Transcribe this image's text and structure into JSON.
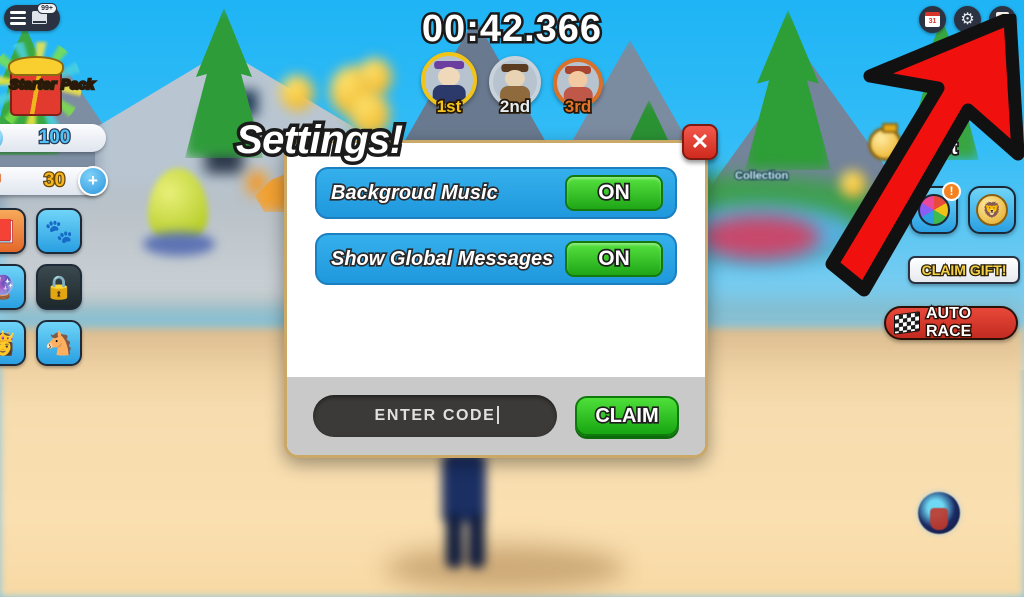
{
  "game": {
    "timer": "00:42.366",
    "world_label": "Collection",
    "rank_indicator": "1st"
  },
  "leaderboard": [
    {
      "rank": "1st",
      "medal_color": "#f0c419",
      "skin": "#f0d8bb",
      "shirt": "#2b3a6b",
      "hat": "#6b3fa0"
    },
    {
      "rank": "2nd",
      "medal_color": "#c9d2da",
      "skin": "#e8d3b4",
      "shirt": "#8f6a3c",
      "hat": "#5a3b22"
    },
    {
      "rank": "3rd",
      "medal_color": "#d9712a",
      "skin": "#f2c9a0",
      "shirt": "#c0584a",
      "hat": "#a8452f"
    }
  ],
  "topleft": {
    "chat_badge": "99+",
    "starter_pack_label": "Starter Pack",
    "currencies": [
      {
        "name": "gems",
        "value": "100",
        "icon": "gem-icon"
      },
      {
        "name": "hearts",
        "value": "30",
        "icon": "heart-icon"
      }
    ],
    "plus_label": "+"
  },
  "sidebar": {
    "items": [
      {
        "name": "shop",
        "glyph": "📕",
        "style": "si-orange"
      },
      {
        "name": "pets",
        "glyph": "🐾",
        "style": "si-blue"
      },
      {
        "name": "eggs",
        "glyph": "🔮",
        "style": "si-blue"
      },
      {
        "name": "locked",
        "glyph": "🔒",
        "style": "si-dark"
      },
      {
        "name": "characters",
        "glyph": "👸",
        "style": "si-blue"
      },
      {
        "name": "mounts",
        "glyph": "🐴",
        "style": "si-blue"
      }
    ]
  },
  "topright": {
    "calendar_day": "31",
    "gear_glyph": "⚙",
    "icons": [
      "calendar-icon",
      "gear-icon",
      "page-icon"
    ]
  },
  "rightpanel": {
    "notif_count": "!",
    "medal_glyph": "🦁",
    "claim_gift_label": "CLAIM GIFT!",
    "auto_race_label": "AUTO RACE"
  },
  "modal": {
    "title": "Settings!",
    "close_label": "✕",
    "rows": [
      {
        "label": "Backgroud Music",
        "toggle": "ON"
      },
      {
        "label": "Show Global Messages",
        "toggle": "ON"
      }
    ],
    "code_placeholder": "ENTER CODE",
    "code_value": "",
    "claim_label": "CLAIM"
  },
  "colors": {
    "panel_blue": "#29a8e8",
    "toggle_green": "#3ecf2a",
    "close_red": "#cf2a1e",
    "arrow_red": "#f0110e",
    "gold": "#f5b81e"
  }
}
